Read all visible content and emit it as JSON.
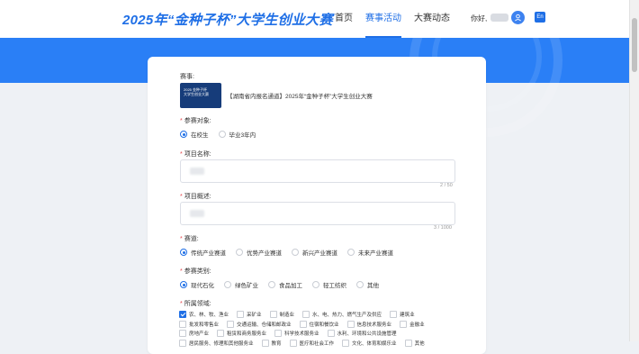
{
  "header": {
    "brand": "2025年“金种子杯”大学生创业大赛",
    "nav": [
      "首页",
      "赛事活动",
      "大赛动态"
    ],
    "active_nav": 1,
    "greeting": "你好,",
    "lang_label": "En"
  },
  "form": {
    "event": {
      "label": "赛事:",
      "thumb_text": "2025 金种子杯 大学生创业大赛",
      "name": "【湖南省内报名通道】2025年“金种子杯”大学生创业大赛"
    },
    "participant": {
      "label": "参赛对象:",
      "options": [
        "在校生",
        "毕业3年内"
      ],
      "selected": 0
    },
    "project_name": {
      "label": "项目名称:",
      "counter": "2 / 50"
    },
    "project_desc": {
      "label": "项目概述:",
      "counter": "3 / 1000"
    },
    "track": {
      "label": "赛道:",
      "options": [
        "传统产业赛道",
        "优势产业赛道",
        "新兴产业赛道",
        "未来产业赛道"
      ],
      "selected": 0
    },
    "category": {
      "label": "参赛类别:",
      "options": [
        "现代石化",
        "绿色矿业",
        "食品加工",
        "轻工纺织",
        "其他"
      ],
      "selected": 0
    },
    "industry": {
      "label": "所属领域:",
      "rows": [
        [
          "农、林、牧、渔业",
          "采矿业",
          "制造业",
          "水、电、热力、燃气生产及供应",
          "建筑业"
        ],
        [
          "批发和零售业",
          "交通运输、仓储和邮政业",
          "住宿和餐饮业",
          "信息技术服务业",
          "金融业"
        ],
        [
          "房地产业",
          "租赁和商务服务业",
          "科学技术服务业",
          "水利、环境和公共设施管理"
        ],
        [
          "居民服务、修理和其他服务业",
          "教育",
          "医疗和社会工作",
          "文化、体育和娱乐业",
          "其他"
        ]
      ],
      "checked": [
        "农、林、牧、渔业"
      ]
    }
  }
}
